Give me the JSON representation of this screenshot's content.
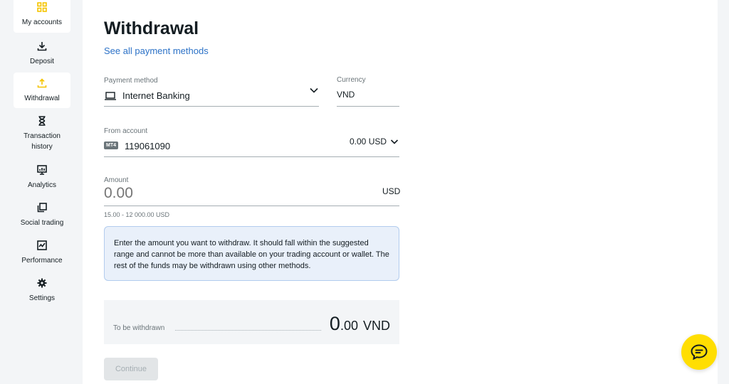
{
  "sidebar": {
    "items": [
      {
        "label": "My accounts",
        "icon": "grid-icon"
      },
      {
        "label": "Deposit",
        "icon": "download-icon"
      },
      {
        "label": "Withdrawal",
        "icon": "upload-icon",
        "active": true
      },
      {
        "label": "Transaction history",
        "icon": "hourglass-icon"
      },
      {
        "label": "Analytics",
        "icon": "analytics-icon"
      },
      {
        "label": "Social trading",
        "icon": "copy-icon"
      },
      {
        "label": "Performance",
        "icon": "performance-icon"
      },
      {
        "label": "Settings",
        "icon": "gear-icon"
      }
    ]
  },
  "page": {
    "title": "Withdrawal",
    "payment_methods_link": "See all payment methods"
  },
  "form": {
    "payment_method": {
      "label": "Payment method",
      "value": "Internet Banking",
      "icon": "laptop-icon"
    },
    "currency": {
      "label": "Currency",
      "value": "VND"
    },
    "from_account": {
      "label": "From account",
      "badge": "MT4",
      "number": "119061090",
      "balance": "0.00 USD"
    },
    "amount": {
      "label": "Amount",
      "placeholder": "0.00",
      "unit": "USD",
      "range": "15.00 - 12 000.00 USD"
    },
    "info": "Enter the amount you want to withdraw. It should fall within the suggested range and cannot be more than available on your trading account or wallet. The rest of the funds may be withdrawn using other methods.",
    "to_be_withdrawn": {
      "label": "To be withdrawn",
      "integer": "0",
      "decimal": ".00",
      "currency": "VND"
    },
    "continue_label": "Continue"
  },
  "colors": {
    "accent": "#ffde02",
    "active_icon": "#f5c400",
    "link": "#2c72c7",
    "info_bg": "#e9f0fa"
  }
}
